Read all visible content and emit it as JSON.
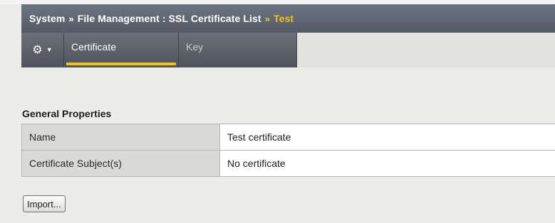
{
  "breadcrumb": {
    "items": [
      "System",
      "File Management : SSL Certificate List"
    ],
    "separator": "»",
    "current": "Test"
  },
  "tabs": {
    "settings_icon": "gear-icon",
    "dropdown_icon": "caret-down-icon",
    "items": [
      {
        "label": "Certificate",
        "active": true
      },
      {
        "label": "Key",
        "active": false
      }
    ]
  },
  "general_properties": {
    "title": "General Properties",
    "rows": [
      {
        "label": "Name",
        "value": "Test certificate"
      },
      {
        "label": "Certificate Subject(s)",
        "value": "No certificate"
      }
    ]
  },
  "actions": {
    "import_label": "Import..."
  },
  "colors": {
    "header_bg": "#5f6672",
    "accent": "#f2c118",
    "page_bg": "#ececea"
  }
}
